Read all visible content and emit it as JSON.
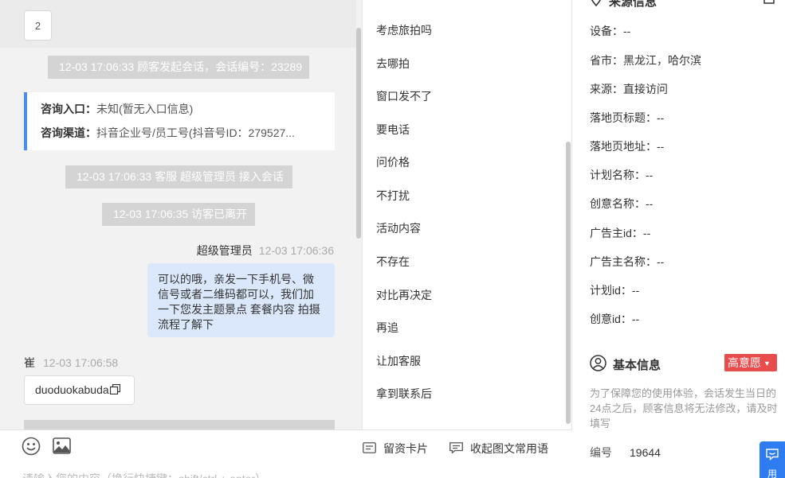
{
  "chat": {
    "page_number": "2",
    "sys_start": "12-03 17:06:33 顾客发起会话，会话编号：23289",
    "source": {
      "entry_label": "咨询入口：",
      "entry_value": "未知(暂无入口信息)",
      "channel_label": "咨询渠道：",
      "channel_value": "抖音企业号/员工号(抖音号ID：279527..."
    },
    "sys_agent_join": "12-03 17:06:33 客服 超级管理员 接入会话",
    "sys_visitor_left": "12-03 17:06:35 访客已离开",
    "agent_name": "超级管理员",
    "agent_time": "12-03 17:06:36",
    "agent_message": "可以的哦，亲发一下手机号、微信号或者二维码都可以，我们加一下您发主题景点 套餐内容 拍摄流程了解下",
    "visitor_name": "崔",
    "visitor_time": "12-03 17:06:58",
    "visitor_message": "duoduokabuda"
  },
  "input": {
    "emoji_icon": "smile-icon",
    "image_icon": "image-icon",
    "card_action": "留资卡片",
    "collapse_action": "收起图文常用语",
    "placeholder": "请输入您的内容（换行快捷键：shift/ctrl + enter）"
  },
  "phrases": {
    "items": [
      "考虑旅拍吗",
      "去哪拍",
      "窗口发不了",
      "要电话",
      "问价格",
      "不打扰",
      "活动内容",
      "不存在",
      "对比再决定",
      "再追",
      "让加客服",
      "拿到联系后"
    ]
  },
  "info": {
    "source_section_title": "来源信息",
    "rows": [
      {
        "label": "设备：",
        "value": "--"
      },
      {
        "label": "省市：",
        "value": "黑龙江，哈尔滨"
      },
      {
        "label": "来源：",
        "value": "直接访问"
      },
      {
        "label": "落地页标题：",
        "value": "--"
      },
      {
        "label": "落地页地址：",
        "value": "--"
      },
      {
        "label": "计划名称：",
        "value": "--"
      },
      {
        "label": "创意名称：",
        "value": "--"
      },
      {
        "label": "广告主id：",
        "value": "--"
      },
      {
        "label": "广告主名称：",
        "value": "--"
      },
      {
        "label": "计划id：",
        "value": "--"
      },
      {
        "label": "创意id：",
        "value": "--"
      }
    ],
    "basic_title": "基本信息",
    "intent_badge": "高意愿",
    "basic_note": "为了保障您的使用体验，会话发生当日的24点之后，顾客信息将无法修改，请及时填写",
    "id_label": "编号",
    "id_value": "19644",
    "side_widget_text": "用"
  },
  "colors": {
    "accent": "#4a8ef0",
    "agent_bubble": "#dbe8fb",
    "system_pill": "#d4d4d4",
    "intent_red": "#e84c4c",
    "widget_blue": "#2f7bf0"
  }
}
